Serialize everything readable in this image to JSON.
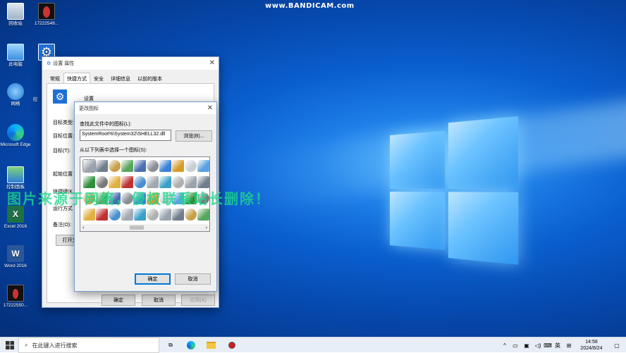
{
  "watermark": "www.BANDICAM.com",
  "overlay_text": "图片来源于网络，侵权联系站长删除！",
  "desktop_icons": [
    {
      "label": "回收站",
      "icon": "recycle-bin-icon"
    },
    {
      "label": "17222549...",
      "icon": "video-thumbnail-icon"
    },
    {
      "label": "此电脑",
      "icon": "computer-icon"
    },
    {
      "label": "网络",
      "icon": "network-icon"
    },
    {
      "label": "控制面板",
      "icon": "control-panel-icon"
    },
    {
      "label": "Microsoft Edge",
      "icon": "edge-icon"
    },
    {
      "label": "Excel 2016",
      "icon": "excel-icon"
    },
    {
      "label": "Word 2016",
      "icon": "word-icon"
    },
    {
      "label": "17222550...",
      "icon": "video-thumbnail-icon"
    },
    {
      "label": "控",
      "icon": "shortcut-icon"
    }
  ],
  "props": {
    "title": "设置 属性",
    "tabs": [
      "常规",
      "快捷方式",
      "安全",
      "详细信息",
      "以前的版本"
    ],
    "active_tab": 1,
    "name": "设置",
    "labels": [
      "目标类型:",
      "目标位置:",
      "目标(T):",
      "起始位置",
      "快捷键(K",
      "运行方式",
      "备注(O):"
    ],
    "open_btn": "打开文",
    "ok": "确定",
    "cancel": "取消",
    "apply": "应用(A)"
  },
  "dialog": {
    "title": "更改图标",
    "find_label": "查找此文件中的图标(L):",
    "path": "SystemRoot%\\System32\\SHELL32.dll",
    "browse": "浏览(B)...",
    "select_label": "从以下列表中选择一个图标(S):",
    "scroll_left": "‹",
    "scroll_right": "›",
    "ok": "确定",
    "cancel": "取消"
  },
  "taskbar": {
    "search_placeholder": "在此键入进行搜索",
    "ime": "英",
    "time": "14:58",
    "date": "2024/8/24"
  },
  "colors": {
    "accent": "#0078d7",
    "desktop": "#0a5fcf"
  }
}
